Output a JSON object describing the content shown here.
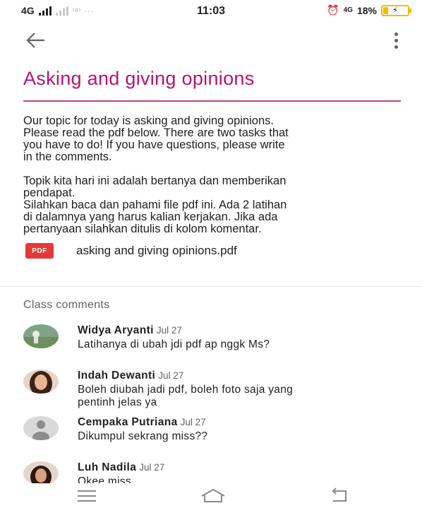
{
  "status_bar": {
    "network": "4G",
    "extra": "⁽ᵒ⁾ ···",
    "time": "11:03",
    "alarm_icon": "alarm-icon",
    "network_right": "4G",
    "battery": "18%"
  },
  "page": {
    "title": "Asking and giving opinions",
    "paragraphs": [
      "Our topic for today is asking and giving opinions.\nPlease read the pdf below. There are two tasks that\nyou have to do! If you have questions,  please write\nin the comments.",
      "Topik kita hari ini adalah bertanya dan memberikan\npendapat.\nSilahkan baca dan pahami file pdf ini. Ada 2 latihan\ndi dalamnya yang harus kalian kerjakan. Jika ada\npertanyaan silahkan ditulis di kolom komentar."
    ],
    "attachment": {
      "badge": "PDF",
      "name": "asking and giving opinions.pdf"
    }
  },
  "comments": {
    "header": "Class comments",
    "items": [
      {
        "name": "Widya Aryanti",
        "date": "Jul 27",
        "text": "Latihanya di ubah jdi pdf ap nggk Ms?"
      },
      {
        "name": "Indah Dewanti",
        "date": "Jul 27",
        "text": "Boleh diubah jadi pdf,  boleh foto saja yang\npentinh jelas ya"
      },
      {
        "name": "Cempaka Putriana",
        "date": "Jul 27",
        "text": "Dikumpul sekrang miss??"
      },
      {
        "name": "Luh Nadila",
        "date": "Jul 27",
        "text": "Okee miss"
      }
    ]
  },
  "colors": {
    "accent": "#b8146f",
    "pdf_badge": "#e53935",
    "battery": "#f0c000"
  }
}
